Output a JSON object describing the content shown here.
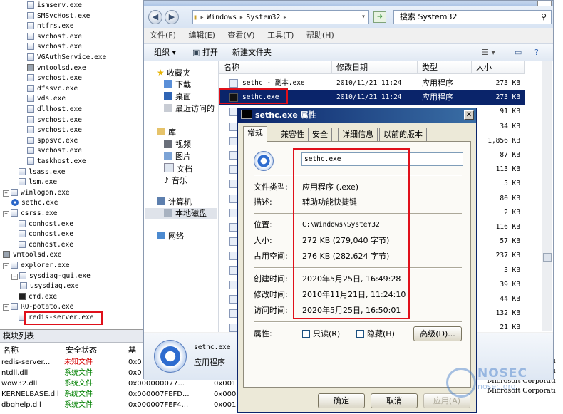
{
  "tree": {
    "items": [
      {
        "label": "ismserv.exe",
        "icon": "process"
      },
      {
        "label": "SMSvcHost.exe",
        "icon": "process"
      },
      {
        "label": "ntfrs.exe",
        "icon": "process"
      },
      {
        "label": "svchost.exe",
        "icon": "process"
      },
      {
        "label": "svchost.exe",
        "icon": "process"
      },
      {
        "label": "VGAuthService.exe",
        "icon": "process"
      },
      {
        "label": "vmtoolsd.exe",
        "icon": "vm"
      },
      {
        "label": "svchost.exe",
        "icon": "process"
      },
      {
        "label": "dfssvc.exe",
        "icon": "process"
      },
      {
        "label": "vds.exe",
        "icon": "process"
      },
      {
        "label": "dllhost.exe",
        "icon": "process"
      },
      {
        "label": "svchost.exe",
        "icon": "process"
      },
      {
        "label": "svchost.exe",
        "icon": "process"
      },
      {
        "label": "sppsvc.exe",
        "icon": "process"
      },
      {
        "label": "svchost.exe",
        "icon": "process"
      },
      {
        "label": "taskhost.exe",
        "icon": "process"
      },
      {
        "label": "lsass.exe",
        "icon": "process"
      },
      {
        "label": "lsm.exe",
        "icon": "process"
      },
      {
        "label": "winlogon.exe",
        "icon": "process"
      },
      {
        "label": "sethc.exe",
        "icon": "blue"
      },
      {
        "label": "csrss.exe",
        "icon": "process"
      },
      {
        "label": "conhost.exe",
        "icon": "process"
      },
      {
        "label": "conhost.exe",
        "icon": "process"
      },
      {
        "label": "conhost.exe",
        "icon": "process"
      },
      {
        "label": "vmtoolsd.exe",
        "icon": "vm"
      },
      {
        "label": "explorer.exe",
        "icon": "process"
      },
      {
        "label": "sysdiag-gui.exe",
        "icon": "process"
      },
      {
        "label": "usysdiag.exe",
        "icon": "process"
      },
      {
        "label": "cmd.exe",
        "icon": "cmd"
      },
      {
        "label": "RO-potato.exe",
        "icon": "process"
      },
      {
        "label": "redis-server.exe",
        "icon": "process"
      }
    ]
  },
  "modules": {
    "title": "模块列表",
    "col_name": "名称",
    "col_status": "安全状态",
    "col_base": "基",
    "rows": [
      {
        "name": "redis-server...",
        "status": "未知文件",
        "status_color": "red",
        "base": "0x0",
        "size": ""
      },
      {
        "name": "ntdll.dll",
        "status": "系统文件",
        "status_color": "green",
        "base": "0x0",
        "size": ""
      },
      {
        "name": "wow32.dll",
        "status": "系统文件",
        "status_color": "green",
        "base": "0x000000077...",
        "size": "0x0011F000"
      },
      {
        "name": "KERNELBASE.dll",
        "status": "系统文件",
        "status_color": "green",
        "base": "0x000007FEFD...",
        "size": "0x0006B000"
      },
      {
        "name": "dbghelp.dll",
        "status": "系统文件",
        "status_color": "green",
        "base": "0x000007FEF4...",
        "size": "0x00125000"
      }
    ],
    "right_rows": [
      "Microsoft Corporati",
      "Microsoft Corporati",
      "Microsoft Corporati",
      "Microsoft Corporati"
    ]
  },
  "explorer": {
    "address": [
      "Windows",
      "System32"
    ],
    "search_placeholder": "搜索 System32",
    "menu": [
      "文件(F)",
      "编辑(E)",
      "查看(V)",
      "工具(T)",
      "帮助(H)"
    ],
    "toolbar": {
      "organize": "组织",
      "open": "打开",
      "new_folder": "新建文件夹"
    },
    "nav": {
      "favorites": "收藏夹",
      "downloads": "下载",
      "desktop": "桌面",
      "recent": "最近访问的",
      "library": "库",
      "videos": "视频",
      "pictures": "图片",
      "documents": "文档",
      "music": "音乐",
      "computer": "计算机",
      "local_disk": "本地磁盘",
      "network": "网络"
    },
    "columns": {
      "name": "名称",
      "modified": "修改日期",
      "type": "类型",
      "size": "大小"
    },
    "files": [
      {
        "name": "sethc - 副本.exe",
        "modified": "2010/11/21 11:24",
        "type": "应用程序",
        "size": "273 KB"
      },
      {
        "name": "sethc.exe",
        "modified": "2010/11/21 11:24",
        "type": "应用程序",
        "size": "273 KB"
      },
      {
        "name": "",
        "modified": "",
        "type": "",
        "size": "91 KB"
      },
      {
        "name": "",
        "modified": "",
        "type": "",
        "size": "34 KB"
      },
      {
        "name": "",
        "modified": "",
        "type": "",
        "size": "1,856 KB"
      },
      {
        "name": "",
        "modified": "",
        "type": "",
        "size": "87 KB"
      },
      {
        "name": "",
        "modified": "",
        "type": "",
        "size": "113 KB"
      },
      {
        "name": "",
        "modified": "",
        "type": "",
        "size": "5 KB"
      },
      {
        "name": "",
        "modified": "",
        "type": "",
        "size": "80 KB"
      },
      {
        "name": "",
        "modified": "",
        "type": "",
        "size": "2 KB"
      },
      {
        "name": "",
        "modified": "",
        "type": "",
        "size": "116 KB"
      },
      {
        "name": "",
        "modified": "",
        "type": "",
        "size": "57 KB"
      },
      {
        "name": "",
        "modified": "",
        "type": "",
        "size": "237 KB"
      },
      {
        "name": "",
        "modified": "",
        "type": "",
        "size": "3 KB"
      },
      {
        "name": "",
        "modified": "",
        "type": "",
        "size": "39 KB"
      },
      {
        "name": "",
        "modified": "",
        "type": "",
        "size": "44 KB"
      },
      {
        "name": "",
        "modified": "",
        "type": "",
        "size": "132 KB"
      },
      {
        "name": "",
        "modified": "",
        "type": "",
        "size": "21 KB"
      }
    ],
    "details": {
      "name": "sethc.exe",
      "type": "应用程序"
    }
  },
  "dialog": {
    "title": "sethc.exe 属性",
    "tabs": [
      "常规",
      "兼容性",
      "安全",
      "详细信息",
      "以前的版本"
    ],
    "filename": "sethc.exe",
    "labels": {
      "filetype": "文件类型:",
      "description": "描述:",
      "location": "位置:",
      "size": "大小:",
      "disk_size": "占用空间:",
      "created": "创建时间:",
      "modified": "修改时间:",
      "accessed": "访问时间:",
      "attributes": "属性:"
    },
    "values": {
      "filetype": "应用程序 (.exe)",
      "description": "辅助功能快捷键",
      "location": "C:\\Windows\\System32",
      "size": "272 KB (279,040 字节)",
      "disk_size": "276 KB (282,624 字节)",
      "created": "2020年5月25日, 16:49:28",
      "modified": "2010年11月21日, 11:24:10",
      "accessed": "2020年5月25日, 16:50:01"
    },
    "readonly": "只读(R)",
    "hidden": "隐藏(H)",
    "advanced": "高级(D)...",
    "ok": "确定",
    "cancel": "取消",
    "apply": "应用(A)"
  },
  "watermark": {
    "brand": "NOSEC",
    "site": "nosec.org"
  },
  "colors": {
    "highlight": "#e0101a",
    "selection": "#0a246a",
    "unknown": "#d40000",
    "system": "#008000"
  }
}
